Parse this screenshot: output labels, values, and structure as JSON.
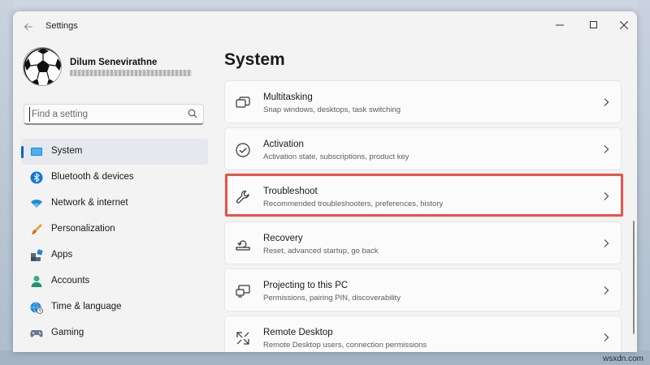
{
  "window": {
    "title": "Settings"
  },
  "profile": {
    "name": "Dilum Senevirathne"
  },
  "search": {
    "placeholder": "Find a setting"
  },
  "sidebar": {
    "items": [
      {
        "label": "System",
        "icon": "monitor-icon",
        "selected": true
      },
      {
        "label": "Bluetooth & devices",
        "icon": "bluetooth-icon"
      },
      {
        "label": "Network & internet",
        "icon": "wifi-icon"
      },
      {
        "label": "Personalization",
        "icon": "paintbrush-icon"
      },
      {
        "label": "Apps",
        "icon": "apps-icon"
      },
      {
        "label": "Accounts",
        "icon": "person-icon"
      },
      {
        "label": "Time & language",
        "icon": "globe-clock-icon"
      },
      {
        "label": "Gaming",
        "icon": "gamepad-icon"
      }
    ]
  },
  "main": {
    "title": "System",
    "cards": [
      {
        "title": "Multitasking",
        "subtitle": "Snap windows, desktops, task switching",
        "icon": "multitasking-icon"
      },
      {
        "title": "Activation",
        "subtitle": "Activation state, subscriptions, product key",
        "icon": "check-circle-icon"
      },
      {
        "title": "Troubleshoot",
        "subtitle": "Recommended troubleshooters, preferences, history",
        "icon": "wrench-icon",
        "highlighted": true
      },
      {
        "title": "Recovery",
        "subtitle": "Reset, advanced startup, go back",
        "icon": "recovery-icon"
      },
      {
        "title": "Projecting to this PC",
        "subtitle": "Permissions, pairing PIN, discoverability",
        "icon": "projecting-icon"
      },
      {
        "title": "Remote Desktop",
        "subtitle": "Remote Desktop users, connection permissions",
        "icon": "remote-desktop-icon"
      }
    ]
  },
  "colors": {
    "accent": "#0067c0",
    "highlight": "#e8534a"
  },
  "watermark": "wsxdn.com"
}
